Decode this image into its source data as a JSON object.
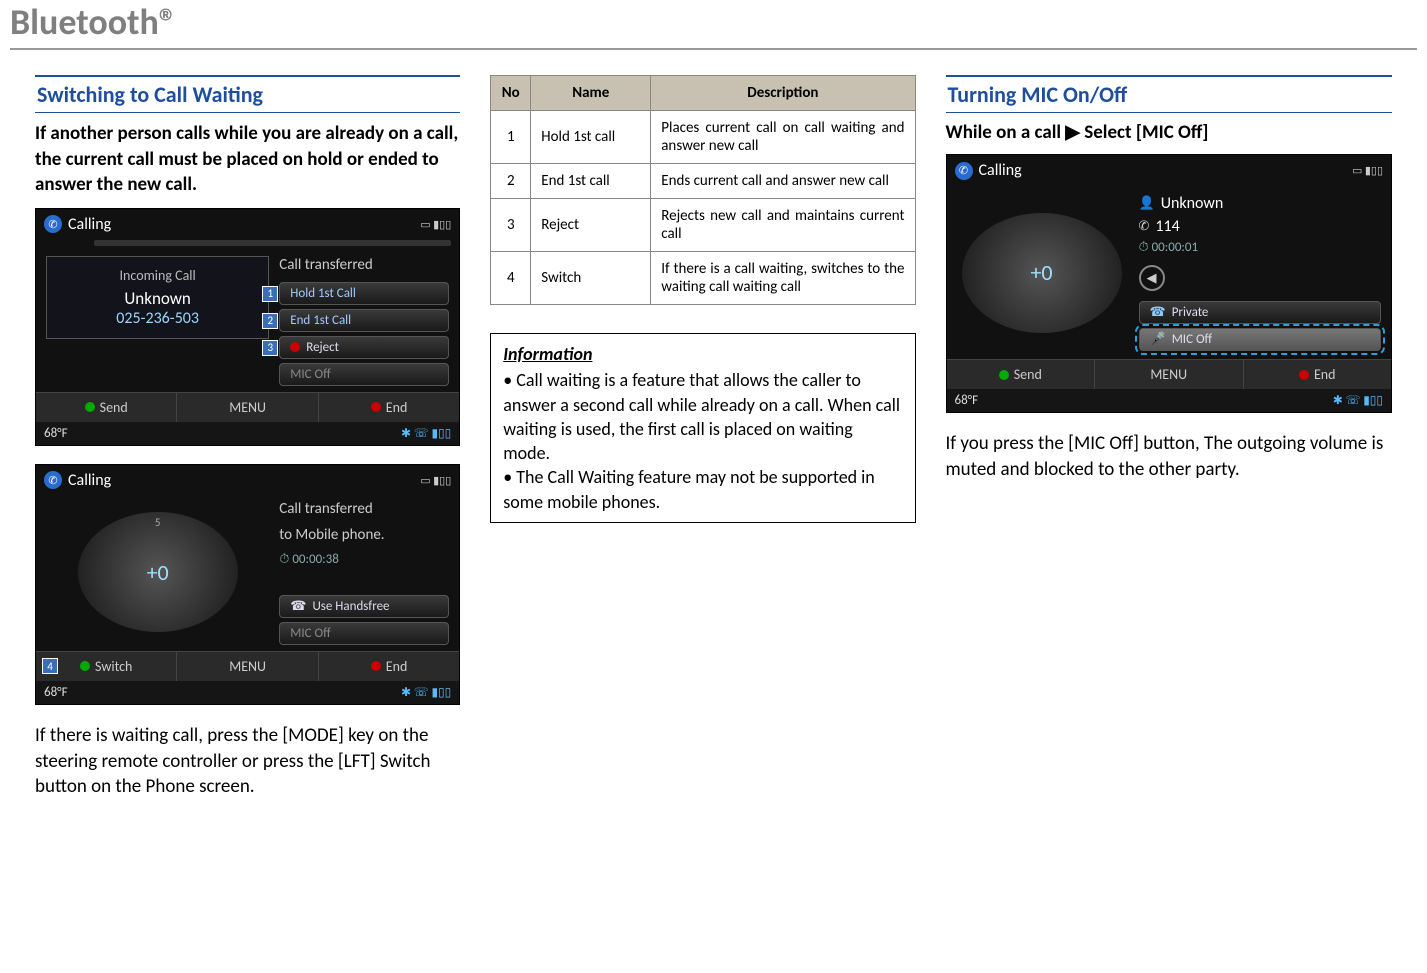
{
  "page_title": "Bluetooth®",
  "col1": {
    "heading": "Switching to Call Waiting",
    "intro": "If another person calls while you are already on a call, the current call must be placed on hold or ended to answer the new call.",
    "shot1": {
      "mode": "Calling",
      "popup_title": "Incoming Call",
      "popup_name": "Unknown",
      "popup_number": "025-236-503",
      "transfer_text": "Call transferred",
      "btn1": "Hold 1st Call",
      "btn2": "End 1st Call",
      "btn3": "Reject",
      "mic": "MIC Off",
      "send": "Send",
      "menu": "MENU",
      "end": "End",
      "temp": "68°F"
    },
    "shot2": {
      "mode": "Calling",
      "transferred1": "Call transferred",
      "transferred2": "to Mobile phone.",
      "time": "00:00:38",
      "handsfree": "Use Handsfree",
      "mic": "MIC Off",
      "switch": "Switch",
      "switch_num": "4",
      "menu": "MENU",
      "end": "End",
      "temp": "68°F",
      "dial_center": "+0"
    },
    "footer_text": "If there is waiting call, press the [MODE] key on the steering remote controller or press the [LFT] Switch button on the Phone screen."
  },
  "col2": {
    "table": {
      "headers": [
        "No",
        "Name",
        "Description"
      ],
      "rows": [
        {
          "no": "1",
          "name": "Hold 1st call",
          "desc": "Places current call on call waiting and answer new call"
        },
        {
          "no": "2",
          "name": "End 1st call",
          "desc": "Ends current call and answer new call"
        },
        {
          "no": "3",
          "name": "Reject",
          "desc": "Rejects new call and maintains current call"
        },
        {
          "no": "4",
          "name": "Switch",
          "desc": "If there is a call waiting, switches to the waiting call waiting call"
        }
      ]
    },
    "info_title": "Information",
    "info_b1": "• Call waiting is a feature that allows the caller to answer a second call while already on a call. When call waiting is used, the first call is placed on waiting mode.",
    "info_b2": "• The Call Waiting feature may not be supported in some mobile phones."
  },
  "col3": {
    "heading": "Turning MIC On/Off",
    "action": "While on a call ▶ Select [MIC Off]",
    "shot": {
      "mode": "Calling",
      "name": "Unknown",
      "num": "114",
      "time": "00:00:01",
      "private": "Private",
      "mic": "MIC Off",
      "send": "Send",
      "menu": "MENU",
      "end": "End",
      "temp": "68°F",
      "dial_center": "+0"
    },
    "result_text": "If you press the [MIC Off] button, The outgoing volume is muted and blocked to the other party."
  }
}
